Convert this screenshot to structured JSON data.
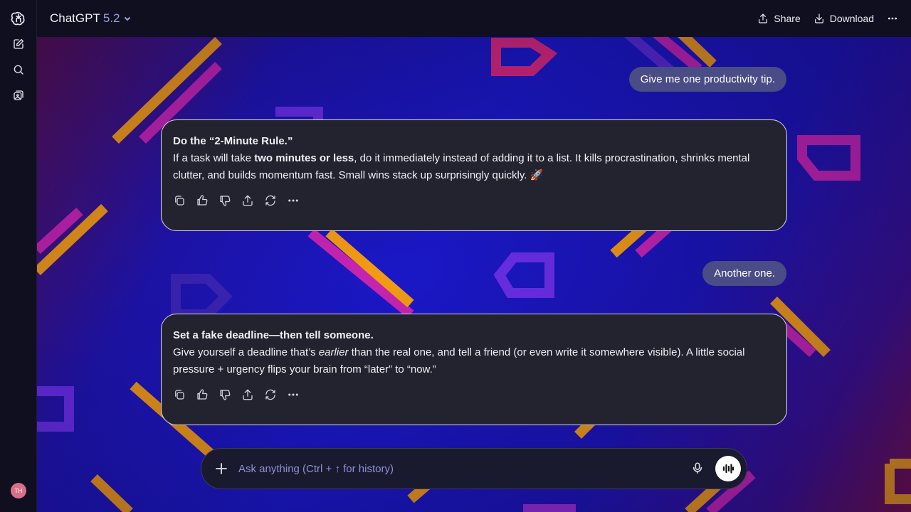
{
  "header": {
    "model_name": "ChatGPT",
    "model_version": "5.2",
    "share_label": "Share",
    "download_label": "Download"
  },
  "sidebar": {
    "avatar_initials": "TH",
    "icons": [
      "openai-logo-icon",
      "new-chat-icon",
      "search-icon",
      "library-icon"
    ]
  },
  "conversation": {
    "user_msg_1": "Give me one productivity tip.",
    "ai_msg_1": {
      "heading": "Do the “2-Minute Rule.”",
      "text_before": "If a task will take ",
      "bold": "two minutes or less",
      "text_after": ", do it immediately instead of adding it to a list. It kills procrastination, shrinks mental clutter, and builds momentum fast. Small wins stack up surprisingly quickly. 🚀"
    },
    "user_msg_2": "Another one.",
    "ai_msg_2": {
      "heading": "Set a fake deadline—then tell someone.",
      "text_before": "Give yourself a deadline that’s ",
      "italic": "earlier",
      "text_after": " than the real one, and tell a friend (or even write it somewhere visible). A little social pressure + urgency flips your brain from “later” to “now.”"
    }
  },
  "composer": {
    "placeholder": "Ask anything (Ctrl + ↑ for history)"
  },
  "colors": {
    "accent_orange": "#f39c12",
    "accent_magenta": "#c724b1",
    "accent_pink": "#e91e73",
    "user_bubble": "#4a4c86",
    "ai_card": "#23222f"
  }
}
